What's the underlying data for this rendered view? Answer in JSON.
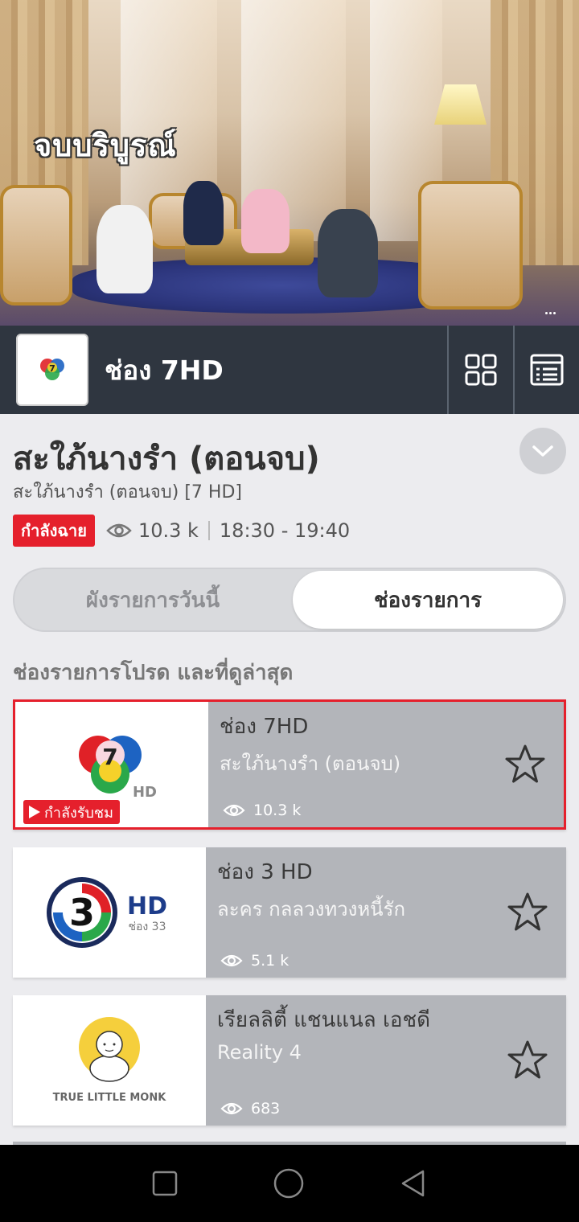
{
  "video": {
    "caption": "จบบริบูรณ์"
  },
  "channel_bar": {
    "name": "ช่อง 7HD"
  },
  "program": {
    "title": "สะใภ้นางรำ (ตอนจบ)",
    "subtitle": "สะใภ้นางรำ (ตอนจบ) [7 HD]",
    "live_label": "กำลังฉาย",
    "views": "10.3 k",
    "time": "18:30 - 19:40"
  },
  "tabs": {
    "left": "ผังรายการวันนี้",
    "right": "ช่องรายการ",
    "selected": "right"
  },
  "section_title": "ช่องรายการโปรด และที่ดูล่าสุด",
  "channels": [
    {
      "name": "ช่อง 7HD",
      "program": "สะใภ้นางรำ (ตอนจบ)",
      "views": "10.3 k",
      "watching_label": "กำลังรับชม",
      "active": true
    },
    {
      "name": "ช่อง 3 HD",
      "program": "ละคร  กลลวงทวงหนี้รัก",
      "views": "5.1 k",
      "logo_sub": "ช่อง 33",
      "logo_hd": "HD"
    },
    {
      "name": "เรียลลิตี้ แชนแนล เอชดี",
      "program": "Reality  4",
      "views": "683",
      "logo_text": "TRUE LITTLE MONK"
    }
  ],
  "colors": {
    "accent_red": "#e5202c",
    "bar_dark": "#2f3640",
    "card_gray": "#b3b5ba",
    "background": "#ececef"
  }
}
